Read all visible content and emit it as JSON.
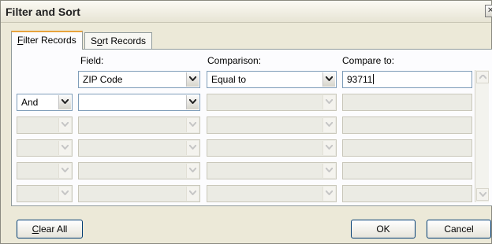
{
  "window": {
    "title": "Filter and Sort"
  },
  "tabs": [
    {
      "pre": "",
      "accel": "F",
      "post": "ilter Records",
      "active": true
    },
    {
      "pre": "S",
      "accel": "o",
      "post": "rt Records",
      "active": false
    }
  ],
  "columns": {
    "field": "Field:",
    "comparison": "Comparison:",
    "compare_to": "Compare to:"
  },
  "rows": [
    {
      "connector": "",
      "field": "ZIP Code",
      "comparison": "Equal to",
      "compare_to": "93711",
      "enabled": true
    },
    {
      "connector": "And",
      "field": "",
      "comparison": "",
      "compare_to": "",
      "enabled": true
    },
    {
      "connector": "",
      "field": "",
      "comparison": "",
      "compare_to": "",
      "enabled": false
    },
    {
      "connector": "",
      "field": "",
      "comparison": "",
      "compare_to": "",
      "enabled": false
    },
    {
      "connector": "",
      "field": "",
      "comparison": "",
      "compare_to": "",
      "enabled": false
    },
    {
      "connector": "",
      "field": "",
      "comparison": "",
      "compare_to": "",
      "enabled": false
    }
  ],
  "buttons": {
    "clear_all": {
      "accel": "C",
      "rest": "lear All"
    },
    "ok": "OK",
    "cancel": "Cancel"
  },
  "icons": {
    "dropdown": "chevron-down-icon",
    "close": "close-icon",
    "scroll_up": "scroll-up-icon",
    "scroll_down": "scroll-down-icon"
  },
  "colors": {
    "control_border": "#7f9db9",
    "active_tab_accent": "#e8a33d",
    "dialog_bg": "#ece9d8"
  }
}
